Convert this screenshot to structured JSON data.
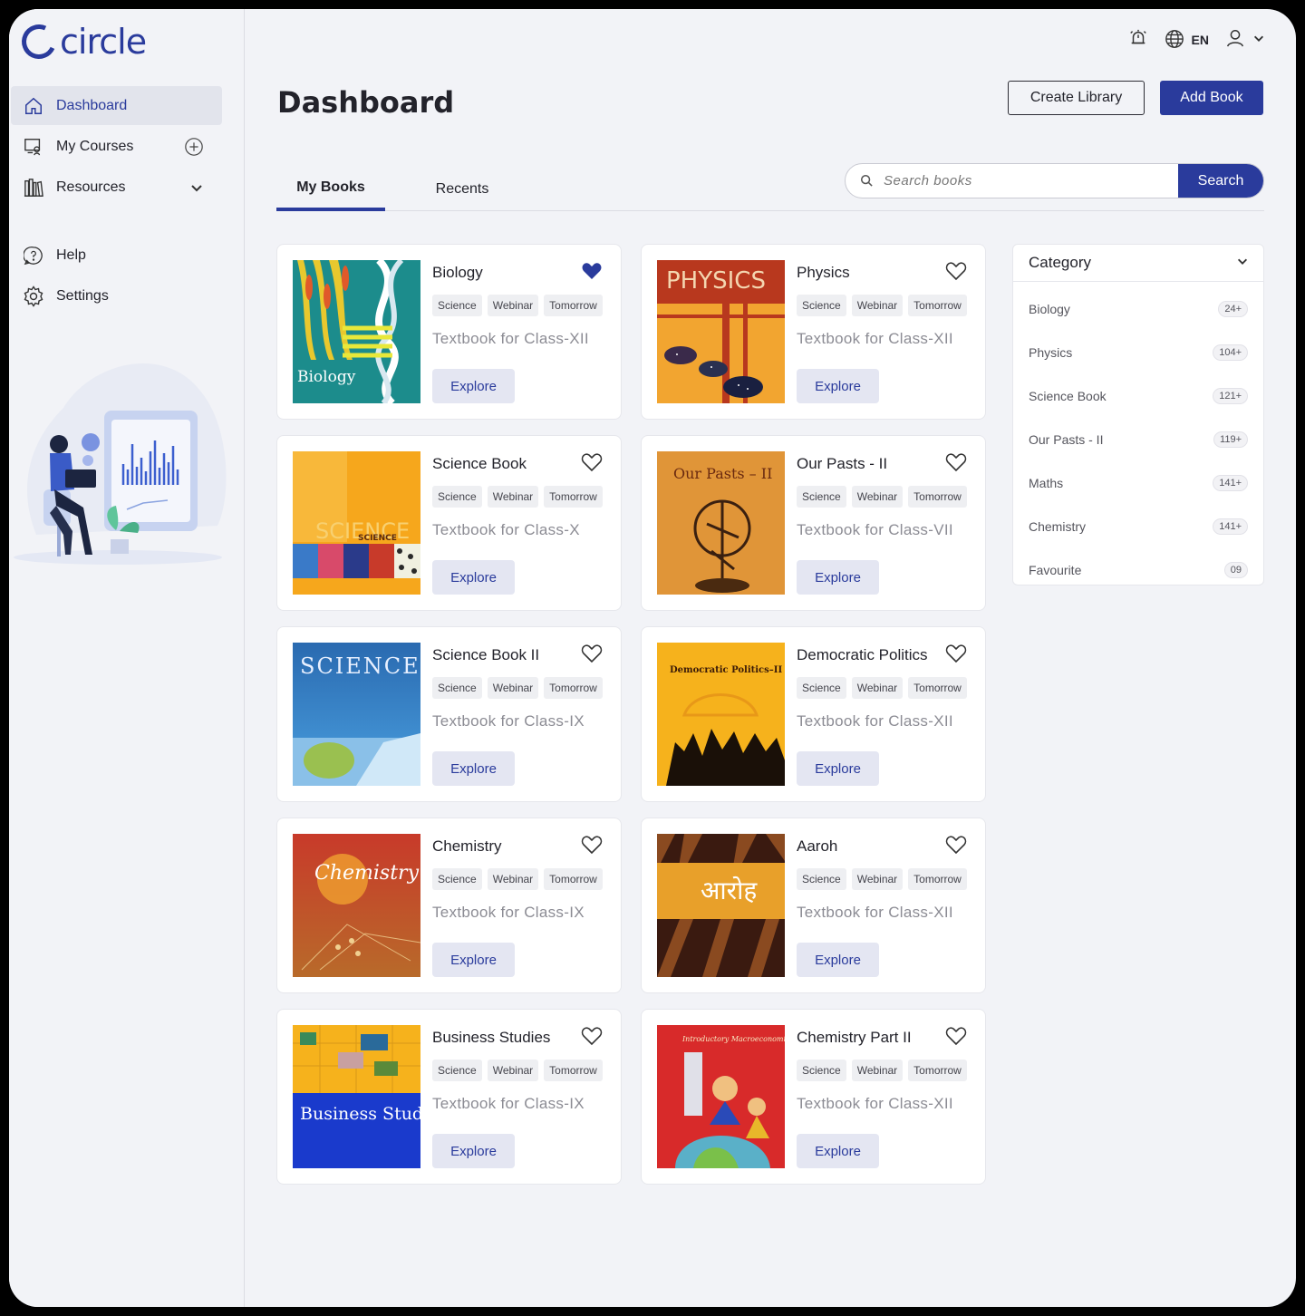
{
  "app": {
    "name": "circle"
  },
  "sidebar": {
    "items": [
      {
        "label": "Dashboard",
        "icon": "home-icon",
        "active": true
      },
      {
        "label": "My Courses",
        "icon": "courses-icon",
        "trail": "add-circle-icon"
      },
      {
        "label": "Resources",
        "icon": "library-icon",
        "trail": "chevron-down-icon"
      },
      {
        "label": "Help",
        "icon": "help-icon"
      },
      {
        "label": "Settings",
        "icon": "gear-icon"
      }
    ]
  },
  "topbar": {
    "language": "EN"
  },
  "header": {
    "title": "Dashboard",
    "create_library": "Create Library",
    "add_book": "Add Book"
  },
  "tabs": [
    {
      "label": "My Books",
      "active": true
    },
    {
      "label": "Recents",
      "active": false
    }
  ],
  "search": {
    "placeholder": "Search books",
    "button": "Search"
  },
  "books": [
    {
      "title": "Biology",
      "tags": [
        "Science",
        "Webinar",
        "Tomorrow"
      ],
      "subtitle": "Textbook for Class-XII",
      "favourite": true,
      "button": "Explore",
      "cover_text": "Biology"
    },
    {
      "title": "Physics",
      "tags": [
        "Science",
        "Webinar",
        "Tomorrow"
      ],
      "subtitle": "Textbook for Class-XII",
      "favourite": false,
      "button": "Explore",
      "cover_text": "PHYSICS"
    },
    {
      "title": "Science Book",
      "tags": [
        "Science",
        "Webinar",
        "Tomorrow"
      ],
      "subtitle": "Textbook for Class-X",
      "favourite": false,
      "button": "Explore",
      "cover_text": "SCIENCE"
    },
    {
      "title": "Our Pasts - II",
      "tags": [
        "Science",
        "Webinar",
        "Tomorrow"
      ],
      "subtitle": "Textbook for Class-VII",
      "favourite": false,
      "button": "Explore",
      "cover_text": "Our Pasts – II"
    },
    {
      "title": "Science Book II",
      "tags": [
        "Science",
        "Webinar",
        "Tomorrow"
      ],
      "subtitle": "Textbook for Class-IX",
      "favourite": false,
      "button": "Explore",
      "cover_text": "SCIENCE"
    },
    {
      "title": "Democratic Politics",
      "tags": [
        "Science",
        "Webinar",
        "Tomorrow"
      ],
      "subtitle": "Textbook for Class-XII",
      "favourite": false,
      "button": "Explore",
      "cover_text": "Democratic Politics–II"
    },
    {
      "title": "Chemistry",
      "tags": [
        "Science",
        "Webinar",
        "Tomorrow"
      ],
      "subtitle": "Textbook for Class-IX",
      "favourite": false,
      "button": "Explore",
      "cover_text": "Chemistry"
    },
    {
      "title": "Aaroh",
      "tags": [
        "Science",
        "Webinar",
        "Tomorrow"
      ],
      "subtitle": "Textbook for Class-XII",
      "favourite": false,
      "button": "Explore",
      "cover_text": "आरोह"
    },
    {
      "title": "Business Studies",
      "tags": [
        "Science",
        "Webinar",
        "Tomorrow"
      ],
      "subtitle": "Textbook for Class-IX",
      "favourite": false,
      "button": "Explore",
      "cover_text": "Business Studies"
    },
    {
      "title": "Chemistry Part II",
      "tags": [
        "Science",
        "Webinar",
        "Tomorrow"
      ],
      "subtitle": "Textbook for Class-XII",
      "favourite": false,
      "button": "Explore",
      "cover_text": "Introductory Macroeconomics"
    }
  ],
  "category": {
    "title": "Category",
    "items": [
      {
        "label": "Biology",
        "count": "24+"
      },
      {
        "label": "Physics",
        "count": "104+"
      },
      {
        "label": "Science Book",
        "count": "121+"
      },
      {
        "label": "Our Pasts - II",
        "count": "119+"
      },
      {
        "label": "Maths",
        "count": "141+"
      },
      {
        "label": "Chemistry",
        "count": "141+"
      },
      {
        "label": "Favourite",
        "count": "09"
      }
    ]
  },
  "colors": {
    "primary": "#2a3b9c",
    "background": "#f2f3f7"
  }
}
